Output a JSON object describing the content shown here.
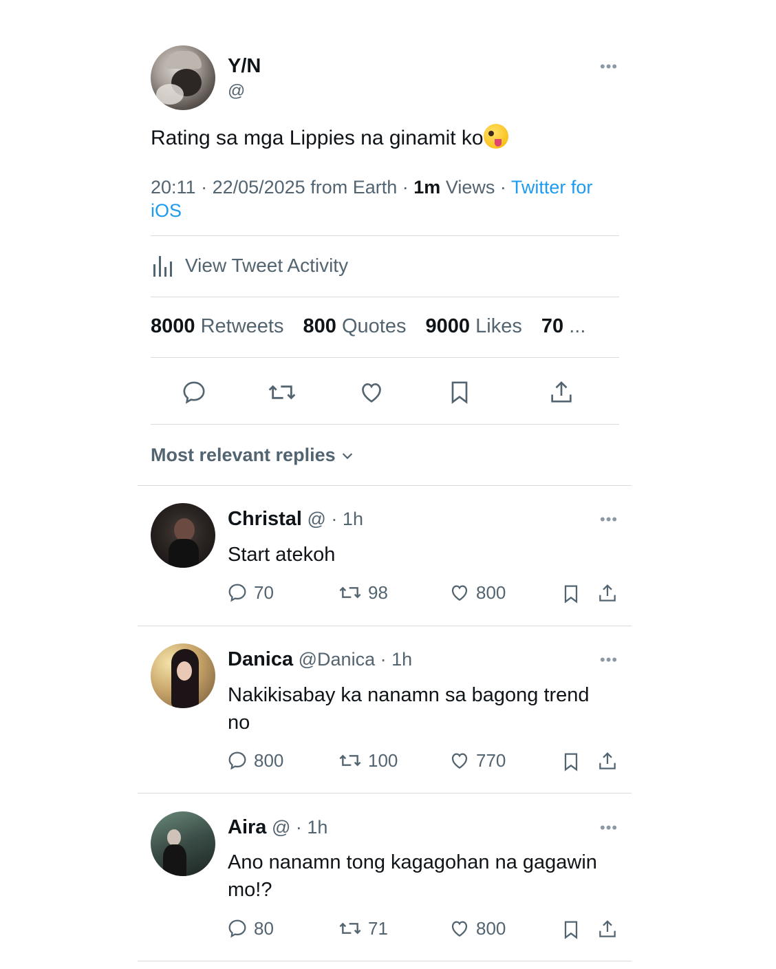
{
  "tweet": {
    "name": "Y/N",
    "handle": "@",
    "text": "Rating sa mga Lippies na ginamit ko",
    "time": "20:11",
    "date": "22/05/2025",
    "location": "from Earth",
    "views_count": "1m",
    "views_label": "Views",
    "source_line1": "Twitter for",
    "source_line2": "iOS",
    "activity_label": "View Tweet Activity",
    "stats": {
      "retweets_count": "8000",
      "retweets_label": "Retweets",
      "quotes_count": "800",
      "quotes_label": "Quotes",
      "likes_count": "9000",
      "likes_label": "Likes",
      "bookmarks_count": "70",
      "bookmarks_label": "..."
    }
  },
  "replies_header": "Most relevant replies",
  "replies": [
    {
      "name": "Christal",
      "handle": "@",
      "time": "1h",
      "text": "Start atekoh",
      "replies": "70",
      "retweets": "98",
      "likes": "800"
    },
    {
      "name": "Danica",
      "handle": "@Danica",
      "time": "1h",
      "text": "Nakikisabay ka nanamn sa bagong trend no",
      "replies": "800",
      "retweets": "100",
      "likes": "770"
    },
    {
      "name": "Aira",
      "handle": "@",
      "time": "1h",
      "text": "Ano nanamn tong kagagohan na gagawin mo!?",
      "replies": "80",
      "retweets": "71",
      "likes": "800"
    }
  ],
  "colors": {
    "text": "#0f1419",
    "secondary": "#536471",
    "link": "#1d9bf0",
    "divider": "#d6dbdf"
  },
  "icons": [
    "more-icon",
    "activity-chart-icon",
    "reply-icon",
    "retweet-icon",
    "like-icon",
    "bookmark-icon",
    "share-icon",
    "chevron-down-icon"
  ]
}
